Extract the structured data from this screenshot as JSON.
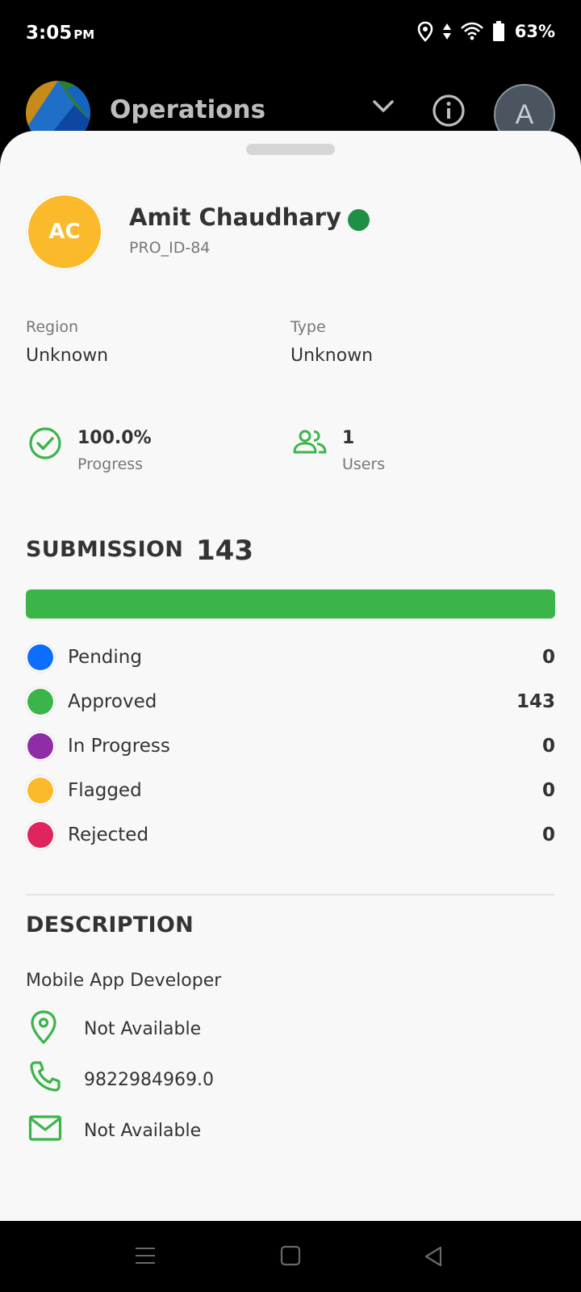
{
  "status_bar": {
    "time": "3:05",
    "ampm": "PM",
    "battery": "63%"
  },
  "header": {
    "title": "Operations",
    "avatar_letter": "A"
  },
  "profile": {
    "initials": "AC",
    "name": "Amit Chaudhary",
    "id": "PRO_ID-84",
    "online_color": "#1f8f45"
  },
  "fields": {
    "region_label": "Region",
    "region_value": "Unknown",
    "type_label": "Type",
    "type_value": "Unknown"
  },
  "stats": {
    "progress_value": "100.0%",
    "progress_label": "Progress",
    "users_value": "1",
    "users_label": "Users"
  },
  "submission": {
    "title": "SUBMISSION",
    "total": "143",
    "bar_fraction": 1.0,
    "bar_color": "#3BB54A",
    "statuses": [
      {
        "label": "Pending",
        "count": "0",
        "color": "#0D6EFD"
      },
      {
        "label": "Approved",
        "count": "143",
        "color": "#3BB54A"
      },
      {
        "label": "In Progress",
        "count": "0",
        "color": "#8E2DA8"
      },
      {
        "label": "Flagged",
        "count": "0",
        "color": "#FBBA2C"
      },
      {
        "label": "Rejected",
        "count": "0",
        "color": "#E0245E"
      }
    ]
  },
  "description": {
    "title": "DESCRIPTION",
    "text": "Mobile App Developer",
    "location": "Not Available",
    "phone": "9822984969.0",
    "email": "Not Available"
  },
  "icons": {
    "accent_color": "#3BB54A"
  }
}
